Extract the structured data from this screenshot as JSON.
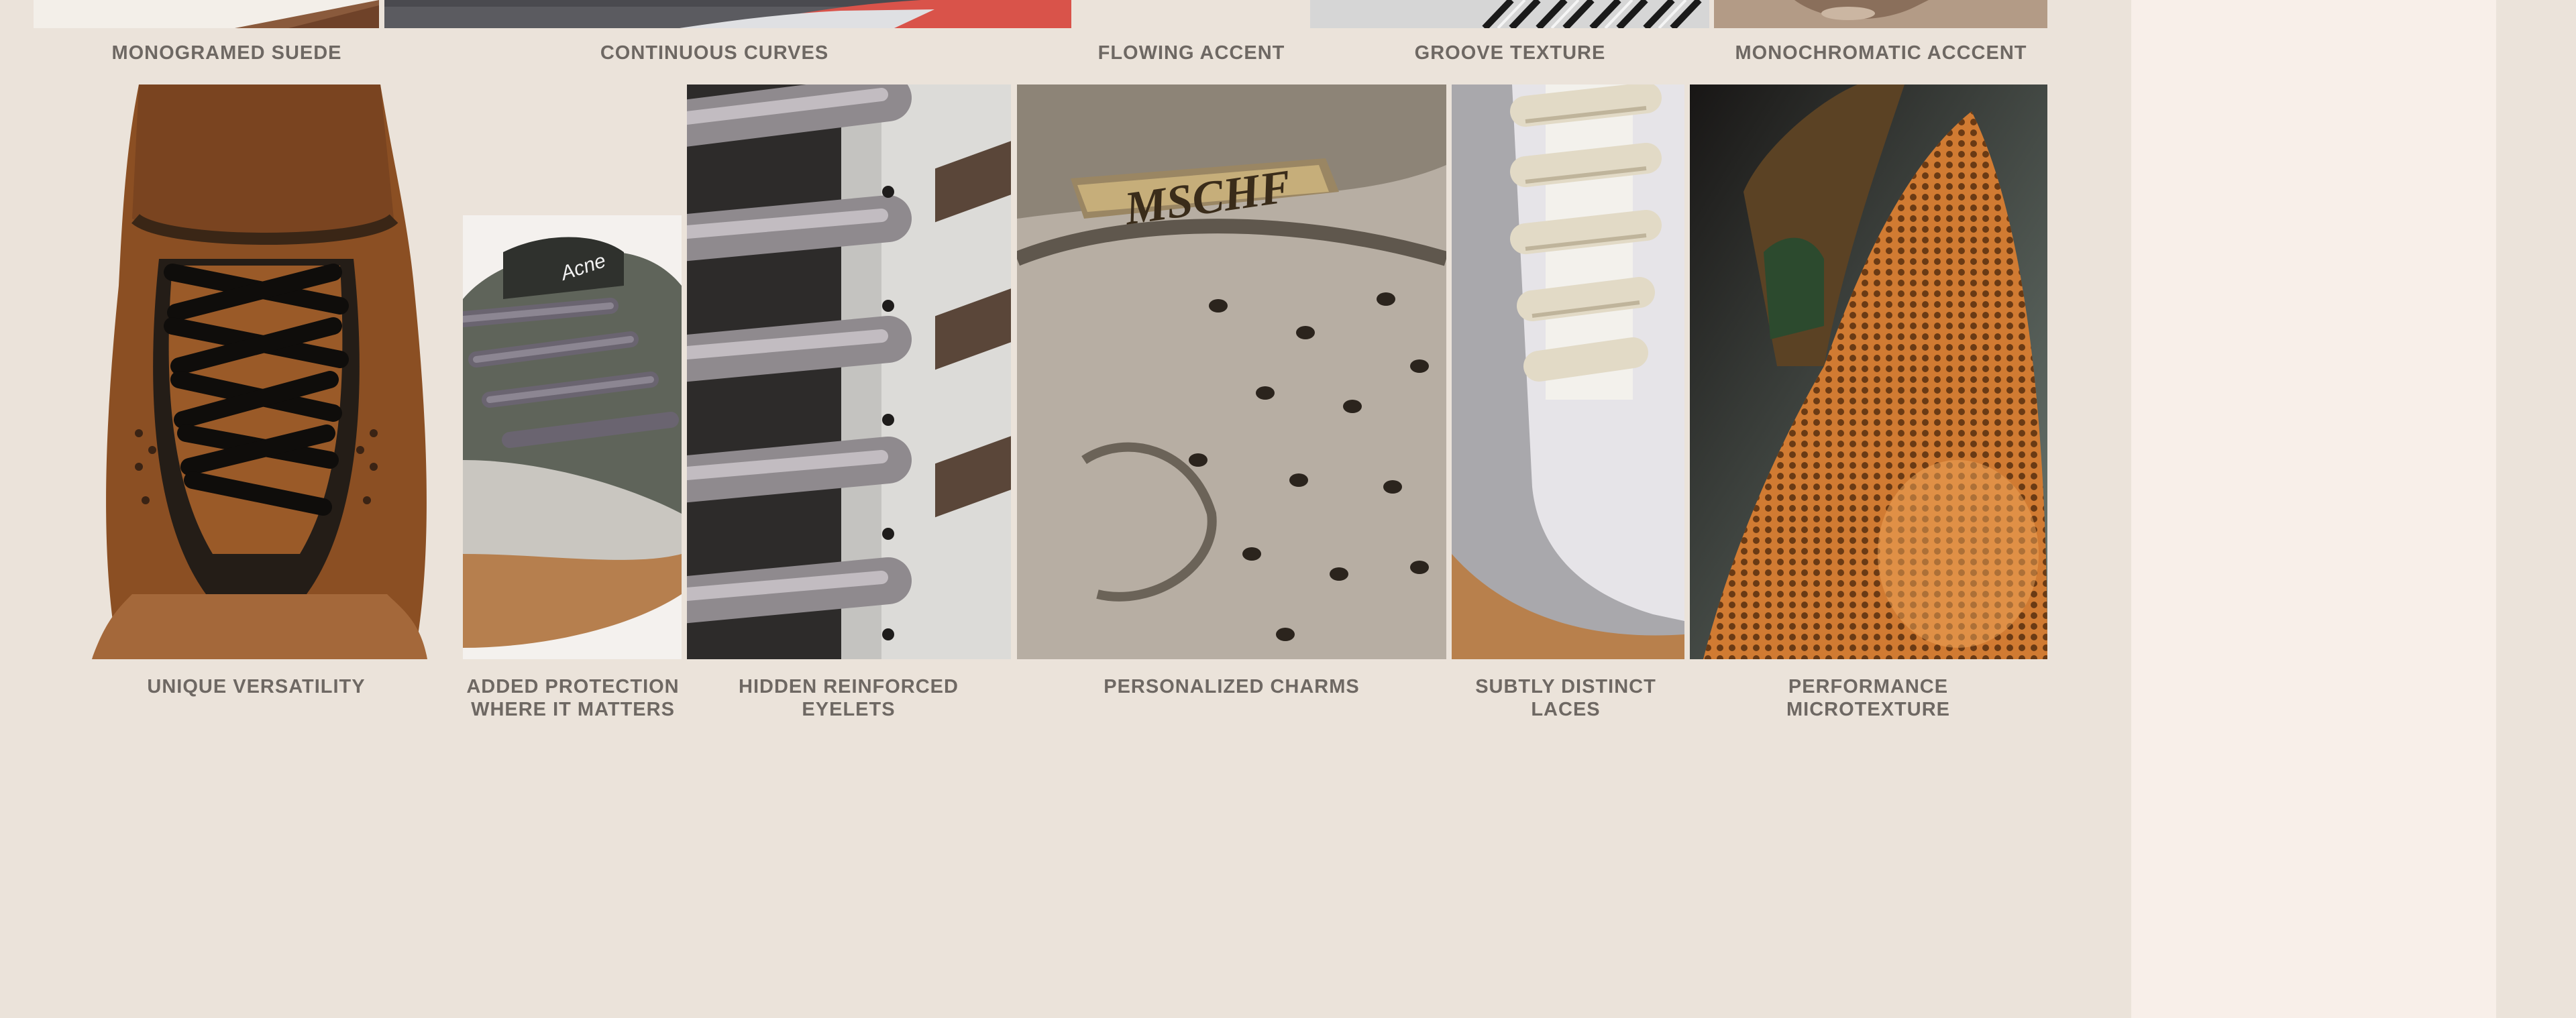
{
  "top_row": {
    "captions": [
      "MONOGRAMED SUEDE",
      "CONTINUOUS CURVES",
      "FLOWING ACCENT",
      "GROOVE TEXTURE",
      "MONOCHROMATIC ACCCENT"
    ]
  },
  "gallery": {
    "items": [
      {
        "caption": "UNIQUE VERSATILITY",
        "image": "brown-suede-sneaker-laces"
      },
      {
        "caption": "ADDED PROTECTION\nWHERE IT MATTERS",
        "image": "grey-sneaker-toe-cap",
        "brand_text": "Acne"
      },
      {
        "caption": "HIDDEN REINFORCED\nEYELETS",
        "image": "grey-lace-eyelets-closeup"
      },
      {
        "caption": "PERSONALIZED CHARMS",
        "image": "perforated-leather-lace-charm",
        "charm_text": "MSCHF"
      },
      {
        "caption": "SUBTLY DISTINCT\nLACES",
        "image": "cream-laces-grey-suede"
      },
      {
        "caption": "PERFORMANCE\nMICROTEXTURE",
        "image": "orange-hex-outsole"
      }
    ]
  }
}
